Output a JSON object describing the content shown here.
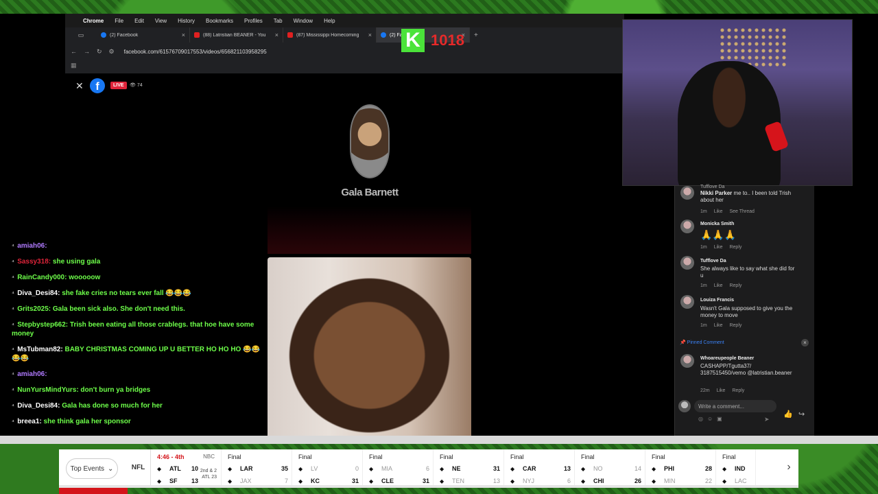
{
  "menubar": {
    "app": "Chrome",
    "items": [
      "File",
      "Edit",
      "View",
      "History",
      "Bookmarks",
      "Profiles",
      "Tab",
      "Window",
      "Help"
    ]
  },
  "tabs": [
    {
      "title": "(2) Facebook",
      "type": "fb"
    },
    {
      "title": "(88) Latristian BEANER - You",
      "type": "yt"
    },
    {
      "title": "(87) Mississippi Homecoming",
      "type": "yt"
    },
    {
      "title": "(2) Fa",
      "type": "fb"
    }
  ],
  "address": {
    "url": "facebook.com/61576709017553/videos/656821103958295"
  },
  "fb_live": {
    "live_label": "LIVE",
    "viewers": "74",
    "host_name": "Gala Barnett"
  },
  "kick": {
    "letter": "K",
    "count": "1018"
  },
  "chat": [
    {
      "user": "amiah06",
      "user_color": "#b07aff",
      "msg": "",
      "msg_color": "#6eff4a"
    },
    {
      "user": "Sassy318",
      "user_color": "#e0243a",
      "msg": "she using gala",
      "msg_color": "#6eff4a"
    },
    {
      "user": "RainCandy000",
      "user_color": "#6eff4a",
      "msg": "wooooow",
      "msg_color": "#6eff4a"
    },
    {
      "user": "Diva_Desi84",
      "user_color": "#ffffff",
      "msg": "she fake cries no tears ever fall 😂😂😂",
      "msg_color": "#6eff4a"
    },
    {
      "user": "Grits2025",
      "user_color": "#6eff4a",
      "msg": "Gala been sick also. She don't need this.",
      "msg_color": "#6eff4a"
    },
    {
      "user": "Stepbystep662",
      "user_color": "#6eff4a",
      "msg": "Trish been eating all those crablegs. that hoe have some money",
      "msg_color": "#6eff4a"
    },
    {
      "user": "MsTubman82",
      "user_color": "#ffffff",
      "msg": "BABY CHRISTMAS COMING UP U BETTER HO HO HO 😂😂😂😂",
      "msg_color": "#6eff4a"
    },
    {
      "user": "amiah06",
      "user_color": "#b07aff",
      "msg": "",
      "msg_color": "#6eff4a"
    },
    {
      "user": "NunYursMindYurs",
      "user_color": "#6eff4a",
      "msg": "don't burn ya bridges",
      "msg_color": "#6eff4a"
    },
    {
      "user": "Diva_Desi84",
      "user_color": "#ffffff",
      "msg": "Gala has done so much for her",
      "msg_color": "#6eff4a"
    },
    {
      "user": "breea1",
      "user_color": "#ffffff",
      "msg": "she think gala her sponsor",
      "msg_color": "#6eff4a"
    }
  ],
  "comments": [
    {
      "name": "Tufflove Da",
      "reply_to": "Nikki Parker",
      "text": "me to.. I been told Trish about her",
      "time": "1m",
      "like": "Like",
      "extra": "See Thread"
    },
    {
      "name": "Monicka Smith",
      "text": "🙏🙏🙏",
      "time": "1m",
      "like": "Like",
      "extra": "Reply"
    },
    {
      "name": "Tufflove Da",
      "text": "She always like to say what she did for u",
      "time": "1m",
      "like": "Like",
      "extra": "Reply"
    },
    {
      "name": "Louiza Francis",
      "text": "Wasn't Gala supposed to give you the money to move",
      "time": "1m",
      "like": "Like",
      "extra": "Reply"
    }
  ],
  "pinned": {
    "label": "Pinned Comment",
    "name": "Whoareupeople Beaner",
    "text": "CASHAPP/Tgutta37/ 3187515450/vemo @latristian.beaner",
    "time": "22m",
    "like": "Like",
    "reply": "Reply"
  },
  "comment_box": {
    "placeholder": "Write a comment..."
  },
  "ticker": {
    "top_events": "Top Events",
    "league": "NFL",
    "games": [
      {
        "status": "4:46 - 4th",
        "live": true,
        "network": "NBC",
        "down": "2nd & 2 ATL 23",
        "away": {
          "team": "ATL",
          "score": "10",
          "lose": false
        },
        "home": {
          "team": "SF",
          "score": "13",
          "lose": false
        }
      },
      {
        "status": "Final",
        "live": false,
        "network": "",
        "away": {
          "team": "LAR",
          "score": "35",
          "lose": false
        },
        "home": {
          "team": "JAX",
          "score": "7",
          "lose": true
        }
      },
      {
        "status": "Final",
        "live": false,
        "network": "",
        "away": {
          "team": "LV",
          "score": "0",
          "lose": true
        },
        "home": {
          "team": "KC",
          "score": "31",
          "lose": false
        }
      },
      {
        "status": "Final",
        "live": false,
        "network": "",
        "away": {
          "team": "MIA",
          "score": "6",
          "lose": true
        },
        "home": {
          "team": "CLE",
          "score": "31",
          "lose": false
        }
      },
      {
        "status": "Final",
        "live": false,
        "network": "",
        "away": {
          "team": "NE",
          "score": "31",
          "lose": false
        },
        "home": {
          "team": "TEN",
          "score": "13",
          "lose": true
        }
      },
      {
        "status": "Final",
        "live": false,
        "network": "",
        "away": {
          "team": "CAR",
          "score": "13",
          "lose": false
        },
        "home": {
          "team": "NYJ",
          "score": "6",
          "lose": true
        }
      },
      {
        "status": "Final",
        "live": false,
        "network": "",
        "away": {
          "team": "NO",
          "score": "14",
          "lose": true
        },
        "home": {
          "team": "CHI",
          "score": "26",
          "lose": false
        }
      },
      {
        "status": "Final",
        "live": false,
        "network": "",
        "away": {
          "team": "PHI",
          "score": "28",
          "lose": false
        },
        "home": {
          "team": "MIN",
          "score": "22",
          "lose": true
        }
      },
      {
        "status": "Final",
        "live": false,
        "network": "",
        "away": {
          "team": "IND",
          "score": "",
          "lose": false
        },
        "home": {
          "team": "LAC",
          "score": "",
          "lose": true
        }
      }
    ]
  }
}
